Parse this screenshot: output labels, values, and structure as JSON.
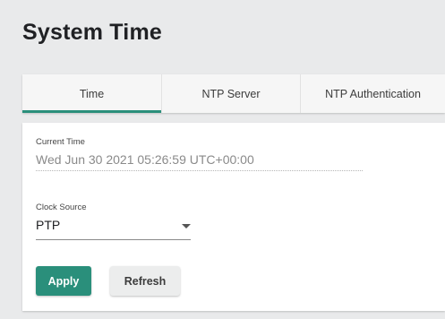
{
  "page": {
    "title": "System Time"
  },
  "tabs": [
    {
      "label": "Time",
      "active": true
    },
    {
      "label": "NTP Server",
      "active": false
    },
    {
      "label": "NTP Authentication",
      "active": false
    }
  ],
  "form": {
    "current_time": {
      "label": "Current Time",
      "value": "Wed Jun 30 2021 05:26:59 UTC+00:00"
    },
    "clock_source": {
      "label": "Clock Source",
      "value": "PTP"
    }
  },
  "buttons": {
    "apply": "Apply",
    "refresh": "Refresh"
  },
  "colors": {
    "accent": "#2a8f7b",
    "background": "#e9eaeb"
  },
  "icons": {
    "select_caret": "chevron-down-icon"
  }
}
